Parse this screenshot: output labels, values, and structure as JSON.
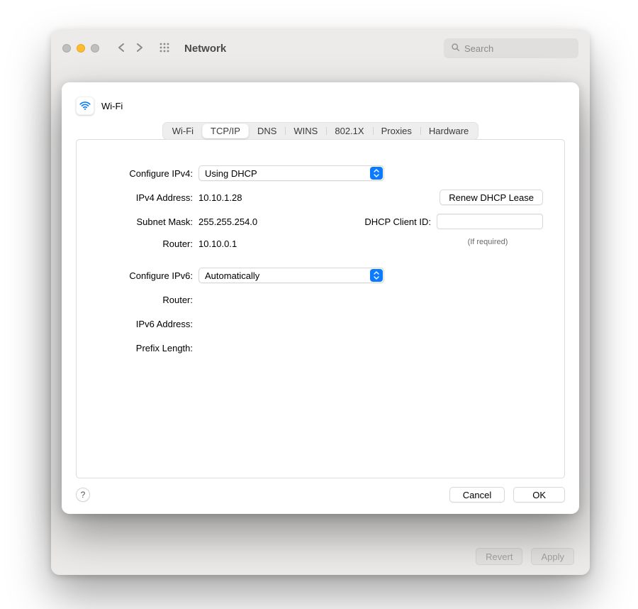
{
  "background": {
    "title": "Network",
    "search_placeholder": "Search",
    "buttons": {
      "revert": "Revert",
      "apply": "Apply"
    }
  },
  "sheet": {
    "interface": "Wi-Fi",
    "tabs": [
      "Wi-Fi",
      "TCP/IP",
      "DNS",
      "WINS",
      "802.1X",
      "Proxies",
      "Hardware"
    ],
    "active_tab": "TCP/IP",
    "ipv4": {
      "configure_label": "Configure IPv4:",
      "configure_value": "Using DHCP",
      "address_label": "IPv4 Address:",
      "address_value": "10.10.1.28",
      "subnet_label": "Subnet Mask:",
      "subnet_value": "255.255.254.0",
      "router_label": "Router:",
      "router_value": "10.10.0.1"
    },
    "dhcp": {
      "renew_button": "Renew DHCP Lease",
      "client_id_label": "DHCP Client ID:",
      "client_id_value": "",
      "hint": "(If required)"
    },
    "ipv6": {
      "configure_label": "Configure IPv6:",
      "configure_value": "Automatically",
      "router_label": "Router:",
      "router_value": "",
      "address_label": "IPv6 Address:",
      "address_value": "",
      "prefix_label": "Prefix Length:",
      "prefix_value": ""
    },
    "footer": {
      "help": "?",
      "cancel": "Cancel",
      "ok": "OK"
    }
  }
}
